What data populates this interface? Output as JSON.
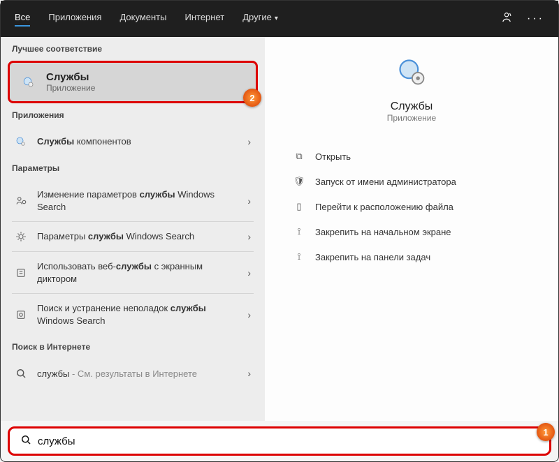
{
  "tabs": {
    "all": "Все",
    "apps": "Приложения",
    "docs": "Документы",
    "web": "Интернет",
    "more": "Другие"
  },
  "left": {
    "bestLabel": "Лучшее соответствие",
    "best": {
      "title": "Службы",
      "sub": "Приложение"
    },
    "appsLabel": "Приложения",
    "compServices_pre": "Службы",
    "compServices_suf": " компонентов",
    "settingsLabel": "Параметры",
    "s1_pre": "Изменение параметров ",
    "s1_b": "службы",
    "s1_suf": " Windows Search",
    "s2_pre": "Параметры ",
    "s2_b": "службы",
    "s2_suf": " Windows Search",
    "s3_pre": "Использовать веб-",
    "s3_b": "службы",
    "s3_suf": " с экранным диктором",
    "s4_pre": "Поиск и устранение неполадок ",
    "s4_b": "службы",
    "s4_suf": " Windows Search",
    "webLabel": "Поиск в Интернете",
    "web_q": "службы",
    "web_suf": " - См. результаты в Интернете"
  },
  "right": {
    "title": "Службы",
    "sub": "Приложение",
    "a1": "Открыть",
    "a2": "Запуск от имени администратора",
    "a3": "Перейти к расположению файла",
    "a4": "Закрепить на начальном экране",
    "a5": "Закрепить на панели задач"
  },
  "search": {
    "value": "службы"
  },
  "badges": {
    "b1": "1",
    "b2": "2"
  }
}
